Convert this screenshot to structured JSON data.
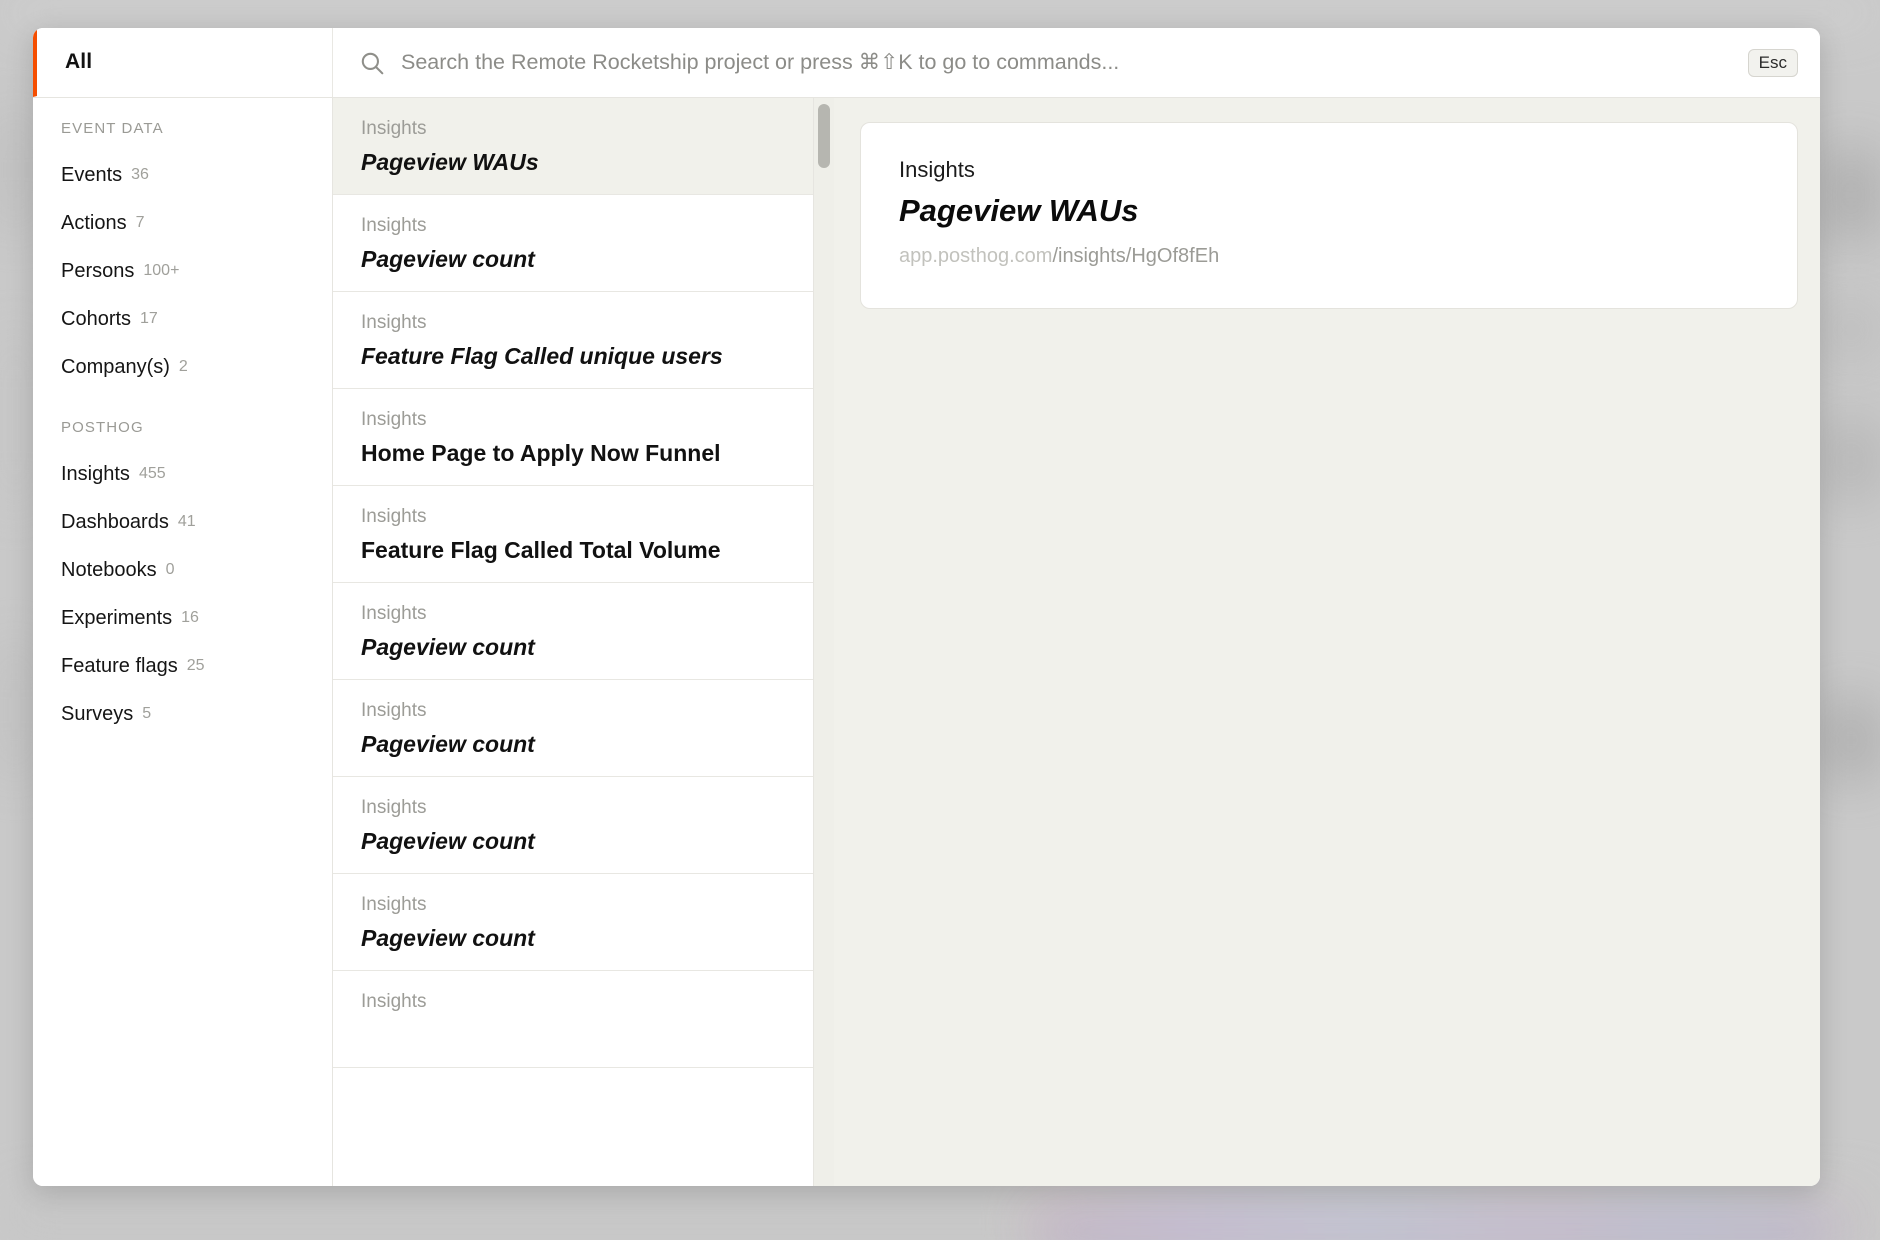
{
  "search": {
    "placeholder": "Search the Remote Rocketship project or press ⌘⇧K to go to commands...",
    "value": "",
    "icon": "search-icon",
    "esc_label": "Esc"
  },
  "tab": {
    "label": "All",
    "accent_color": "#f54e00"
  },
  "sidebar": {
    "groups": [
      {
        "title": "EVENT DATA",
        "items": [
          {
            "label": "Events",
            "count": "36"
          },
          {
            "label": "Actions",
            "count": "7"
          },
          {
            "label": "Persons",
            "count": "100+"
          },
          {
            "label": "Cohorts",
            "count": "17"
          },
          {
            "label": "Company(s)",
            "count": "2"
          }
        ]
      },
      {
        "title": "POSTHOG",
        "items": [
          {
            "label": "Insights",
            "count": "455"
          },
          {
            "label": "Dashboards",
            "count": "41"
          },
          {
            "label": "Notebooks",
            "count": "0"
          },
          {
            "label": "Experiments",
            "count": "16"
          },
          {
            "label": "Feature flags",
            "count": "25"
          },
          {
            "label": "Surveys",
            "count": "5"
          }
        ]
      }
    ]
  },
  "results": [
    {
      "kind": "Insights",
      "title": "Pageview WAUs",
      "italic": true,
      "selected": true
    },
    {
      "kind": "Insights",
      "title": "Pageview count",
      "italic": true,
      "selected": false
    },
    {
      "kind": "Insights",
      "title": "Feature Flag Called unique users",
      "italic": true,
      "selected": false
    },
    {
      "kind": "Insights",
      "title": "Home Page to Apply Now Funnel",
      "italic": false,
      "selected": false
    },
    {
      "kind": "Insights",
      "title": "Feature Flag Called Total Volume",
      "italic": false,
      "selected": false
    },
    {
      "kind": "Insights",
      "title": "Pageview count",
      "italic": true,
      "selected": false
    },
    {
      "kind": "Insights",
      "title": "Pageview count",
      "italic": true,
      "selected": false
    },
    {
      "kind": "Insights",
      "title": "Pageview count",
      "italic": true,
      "selected": false
    },
    {
      "kind": "Insights",
      "title": "Pageview count",
      "italic": true,
      "selected": false
    },
    {
      "kind": "Insights",
      "title": "",
      "italic": true,
      "selected": false
    }
  ],
  "detail": {
    "kind": "Insights",
    "title": "Pageview WAUs",
    "url_host": "app.posthog.com",
    "url_path": "/insights/HgOf8fEh"
  },
  "colors": {
    "accent": "#f54e00",
    "panel_bg": "#f1f1eb",
    "selected_row": "#f1f1eb",
    "border": "#e6e5e0"
  }
}
